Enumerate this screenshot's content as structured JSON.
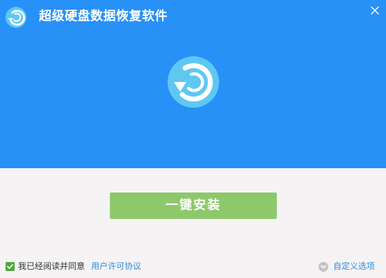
{
  "window": {
    "title": "超级硬盘数据恢复软件"
  },
  "icons": {
    "app_logo": "recovery-logo-icon",
    "close": "close-icon",
    "hero": "recovery-logo-icon",
    "checkbox": "check-icon",
    "options": "chevron-down-circle-icon"
  },
  "main": {
    "install_label": "一键安装"
  },
  "footer": {
    "agree_text": "我已经阅读并同意",
    "agree_checked": true,
    "license_link": "用户许可协议",
    "custom_options": "自定义选项"
  },
  "colors": {
    "header_bg": "#2891f7",
    "logo_circle": "#5ec8f3",
    "install_button": "#8dc86a",
    "checkbox": "#4caa3b",
    "link": "#2a8de6",
    "body_bg": "#f5f3f3"
  }
}
